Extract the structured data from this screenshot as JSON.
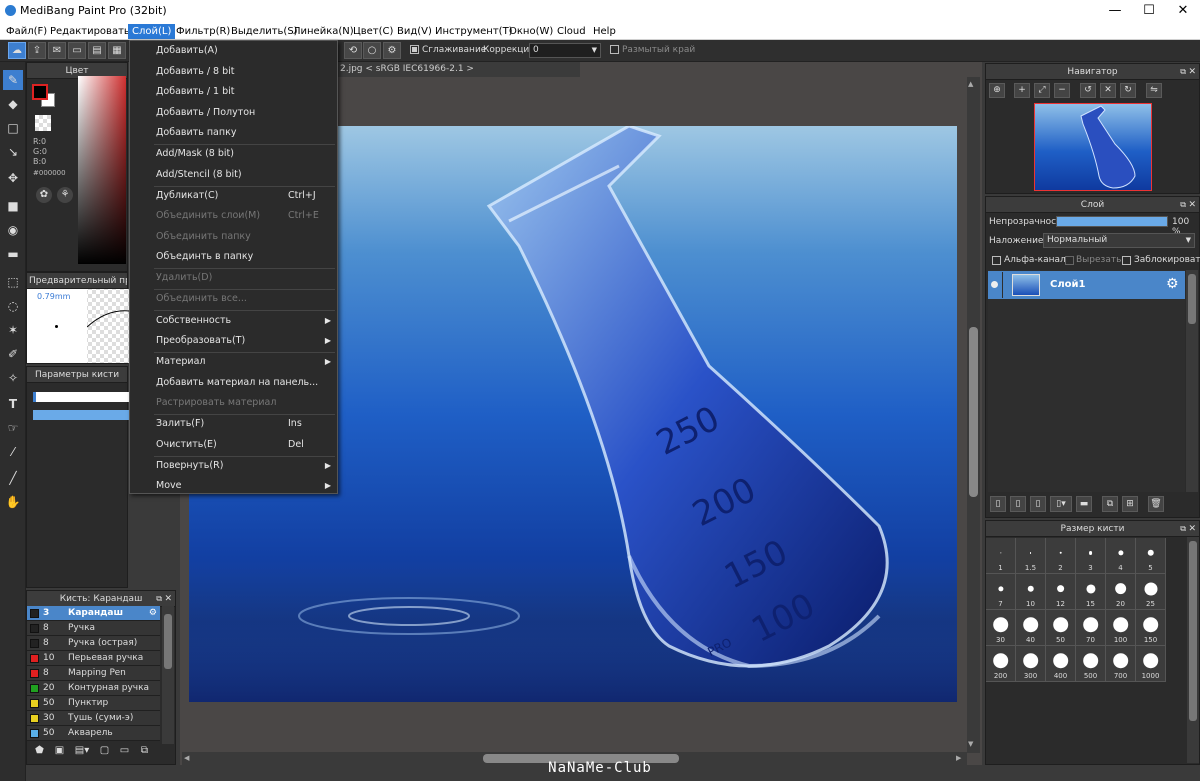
{
  "window": {
    "title": "MediBang Paint Pro (32bit)",
    "minimize": "—",
    "maximize": "☐",
    "close": "✕"
  },
  "menubar": [
    "Файл(F)",
    "Редактировать(E)",
    "Слой(L)",
    "Фильтр(R)",
    "Выделить(S)",
    "Линейка(N)",
    "Цвет(C)",
    "Вид(V)",
    "Инструмент(T)",
    "Окно(W)",
    "Cloud",
    "Help"
  ],
  "active_menu": "Слой(L)",
  "toolbar": {
    "antialias_label": "Сглаживание",
    "correction_label": "Коррекция",
    "correction_value": "0",
    "blur_edge_label": "Размытый край"
  },
  "document_tab": "2.jpg < sRGB IEC61966-2.1 >",
  "layer_menu": [
    {
      "label": "Добавить(A)",
      "shortcut": "",
      "enabled": true,
      "submenu": false
    },
    {
      "label": "Добавить / 8 bit",
      "shortcut": "",
      "enabled": true,
      "submenu": false
    },
    {
      "label": "Добавить / 1 bit",
      "shortcut": "",
      "enabled": true,
      "submenu": false
    },
    {
      "label": "Добавить / Полутон",
      "shortcut": "",
      "enabled": true,
      "submenu": false
    },
    {
      "label": "Добавить папку",
      "shortcut": "",
      "enabled": true,
      "submenu": false
    },
    {
      "label": "Add/Mask (8 bit)",
      "shortcut": "",
      "enabled": true,
      "submenu": false
    },
    {
      "label": "Add/Stencil (8 bit)",
      "shortcut": "",
      "enabled": true,
      "submenu": false
    },
    {
      "label": "Дубликат(C)",
      "shortcut": "Ctrl+J",
      "enabled": true,
      "submenu": false
    },
    {
      "label": "Объединить слои(M)",
      "shortcut": "Ctrl+E",
      "enabled": false,
      "submenu": false
    },
    {
      "label": "Объединить папку",
      "shortcut": "",
      "enabled": false,
      "submenu": false
    },
    {
      "label": "Объединть в папку",
      "shortcut": "",
      "enabled": true,
      "submenu": false
    },
    {
      "label": "Удалить(D)",
      "shortcut": "",
      "enabled": false,
      "submenu": false
    },
    {
      "label": "Объединить все...",
      "shortcut": "",
      "enabled": false,
      "submenu": false
    },
    {
      "label": "Собственность",
      "shortcut": "",
      "enabled": true,
      "submenu": true
    },
    {
      "label": "Преобразовать(T)",
      "shortcut": "",
      "enabled": true,
      "submenu": true
    },
    {
      "label": "Материал",
      "shortcut": "",
      "enabled": true,
      "submenu": true
    },
    {
      "label": "Добавить материал на панель...",
      "shortcut": "",
      "enabled": true,
      "submenu": false
    },
    {
      "label": "Растрировать материал",
      "shortcut": "",
      "enabled": false,
      "submenu": false
    },
    {
      "label": "Залить(F)",
      "shortcut": "Ins",
      "enabled": true,
      "submenu": false
    },
    {
      "label": "Очистить(E)",
      "shortcut": "Del",
      "enabled": true,
      "submenu": false
    },
    {
      "label": "Повернуть(R)",
      "shortcut": "",
      "enabled": true,
      "submenu": true
    },
    {
      "label": "Move",
      "shortcut": "",
      "enabled": true,
      "submenu": true
    }
  ],
  "color_panel": {
    "title": "Цвет",
    "r": "R:0",
    "g": "G:0",
    "b": "B:0",
    "hex": "#000000",
    "foreground": "#000000",
    "background": "#ffffff"
  },
  "preview_panel": {
    "title": "Предварительный просмотр",
    "size": "0.79mm"
  },
  "brush_params": {
    "title": "Параметры кисти"
  },
  "brush_panel": {
    "title": "Кисть: Карандаш",
    "items": [
      {
        "num": "3",
        "name": "Карандаш",
        "color": "#222222",
        "selected": true
      },
      {
        "num": "8",
        "name": "Ручка",
        "color": "#222222",
        "selected": false
      },
      {
        "num": "8",
        "name": "Ручка (острая)",
        "color": "#222222",
        "selected": false
      },
      {
        "num": "10",
        "name": "Перьевая ручка",
        "color": "#e02020",
        "selected": false
      },
      {
        "num": "8",
        "name": "Mapping Pen",
        "color": "#e02020",
        "selected": false
      },
      {
        "num": "20",
        "name": "Контурная ручка",
        "color": "#20a020",
        "selected": false
      },
      {
        "num": "50",
        "name": "Пунктир",
        "color": "#e8d020",
        "selected": false
      },
      {
        "num": "30",
        "name": "Тушь (суми-э)",
        "color": "#e8d020",
        "selected": false
      },
      {
        "num": "50",
        "name": "Акварель",
        "color": "#5ab0e8",
        "selected": false
      }
    ]
  },
  "navigator": {
    "title": "Навигатор"
  },
  "layer_panel": {
    "title": "Слой",
    "opacity_label": "Непрозрачность",
    "opacity_value": "100 %",
    "opacity": 1.0,
    "blend_label": "Наложение",
    "blend_value": "Нормальный",
    "alpha_label": "Альфа-канал",
    "clip_label": "Вырезать",
    "lock_label": "Заблокировать",
    "layers": [
      {
        "name": "Слой1",
        "selected": true
      }
    ]
  },
  "brush_size_panel": {
    "title": "Размер кисти",
    "sizes": [
      "1",
      "1.5",
      "2",
      "3",
      "4",
      "5",
      "7",
      "10",
      "12",
      "15",
      "20",
      "25",
      "30",
      "40",
      "50",
      "70",
      "100",
      "150",
      "200",
      "300",
      "400",
      "500",
      "700",
      "1000"
    ]
  },
  "canvas": {
    "flask_marks": [
      "250",
      "200",
      "150",
      "100"
    ],
    "flask_brand": "PRO"
  },
  "watermark": "NaNaMe-Club"
}
